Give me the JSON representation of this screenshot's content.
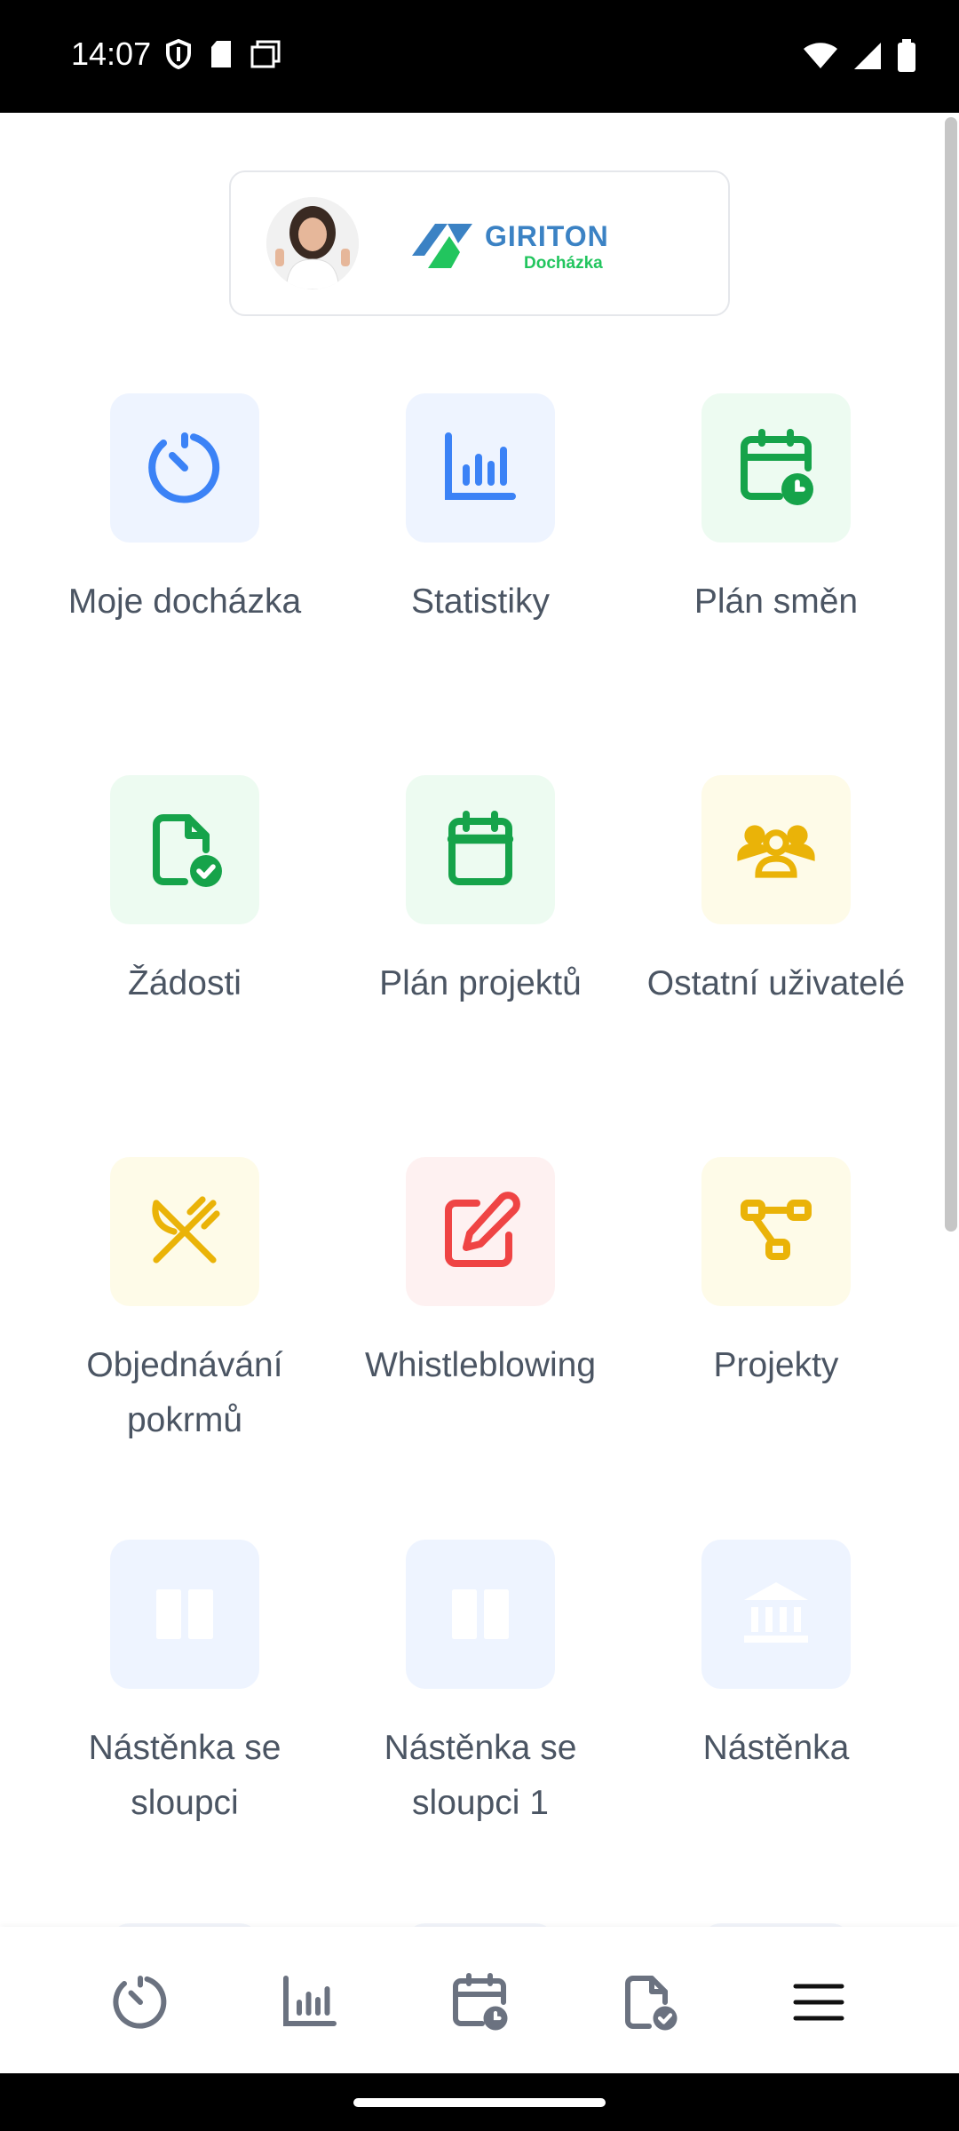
{
  "status_bar": {
    "time": "14:07",
    "left_icons": [
      "shield-icon",
      "sd-card-icon",
      "copy-icon"
    ],
    "right_icons": [
      "wifi-icon",
      "signal-icon",
      "battery-icon"
    ]
  },
  "brand": {
    "name": "GIRITON",
    "subtitle": "Docházka"
  },
  "colors": {
    "blue": "#3b82f6",
    "green": "#16a34a",
    "yellow": "#eab308",
    "red": "#ef4444"
  },
  "tiles": [
    {
      "label": "Moje docházka",
      "icon": "stopwatch-icon"
    },
    {
      "label": "Statistiky",
      "icon": "bar-chart-icon"
    },
    {
      "label": "Plán směn",
      "icon": "calendar-clock-icon"
    },
    {
      "label": "Žádosti",
      "icon": "file-check-icon"
    },
    {
      "label": "Plán projektů",
      "icon": "calendar-icon"
    },
    {
      "label": "Ostatní uživatelé",
      "icon": "users-icon"
    },
    {
      "label": "Objednávání pokrmů",
      "icon": "utensils-icon"
    },
    {
      "label": "Whistleblowing",
      "icon": "pen-square-icon"
    },
    {
      "label": "Projekty",
      "icon": "workflow-icon"
    },
    {
      "label": "Nástěnka se sloupci",
      "icon": "columns-icon"
    },
    {
      "label": "Nástěnka se sloupci 1",
      "icon": "columns-icon"
    },
    {
      "label": "Nástěnka",
      "icon": "bank-icon"
    }
  ],
  "bottom_nav": [
    {
      "icon": "stopwatch-icon"
    },
    {
      "icon": "bar-chart-icon"
    },
    {
      "icon": "calendar-clock-icon"
    },
    {
      "icon": "file-check-icon"
    },
    {
      "icon": "menu-icon"
    }
  ]
}
